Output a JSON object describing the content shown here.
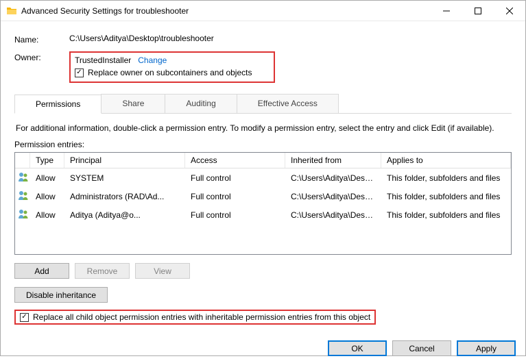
{
  "window": {
    "title": "Advanced Security Settings for troubleshooter"
  },
  "name": {
    "label": "Name:",
    "value": "C:\\Users\\Aditya\\Desktop\\troubleshooter"
  },
  "owner": {
    "label": "Owner:",
    "value": "TrustedInstaller",
    "change_link": "Change",
    "replace_label": "Replace owner on subcontainers and objects",
    "replace_checked": true
  },
  "tabs": {
    "items": [
      {
        "label": "Permissions",
        "active": true
      },
      {
        "label": "Share",
        "active": false
      },
      {
        "label": "Auditing",
        "active": false
      },
      {
        "label": "Effective Access",
        "active": false
      }
    ]
  },
  "info_text": "For additional information, double-click a permission entry. To modify a permission entry, select the entry and click Edit (if available).",
  "entries": {
    "heading": "Permission entries:",
    "columns": {
      "type": "Type",
      "principal": "Principal",
      "access": "Access",
      "inherited": "Inherited from",
      "applies": "Applies to"
    },
    "rows": [
      {
        "type": "Allow",
        "principal": "SYSTEM",
        "access": "Full control",
        "inherited": "C:\\Users\\Aditya\\Deskt...",
        "applies": "This folder, subfolders and files"
      },
      {
        "type": "Allow",
        "principal": "Administrators (RAD\\Ad...",
        "access": "Full control",
        "inherited": "C:\\Users\\Aditya\\Deskt...",
        "applies": "This folder, subfolders and files"
      },
      {
        "type": "Allow",
        "principal": "Aditya (Aditya@o...",
        "access": "Full control",
        "inherited": "C:\\Users\\Aditya\\Deskt...",
        "applies": "This folder, subfolders and files"
      }
    ]
  },
  "buttons": {
    "add": "Add",
    "remove": "Remove",
    "view": "View",
    "disable_inheritance": "Disable inheritance",
    "ok": "OK",
    "cancel": "Cancel",
    "apply": "Apply"
  },
  "replace_all": {
    "label": "Replace all child object permission entries with inheritable permission entries from this object",
    "checked": true
  }
}
